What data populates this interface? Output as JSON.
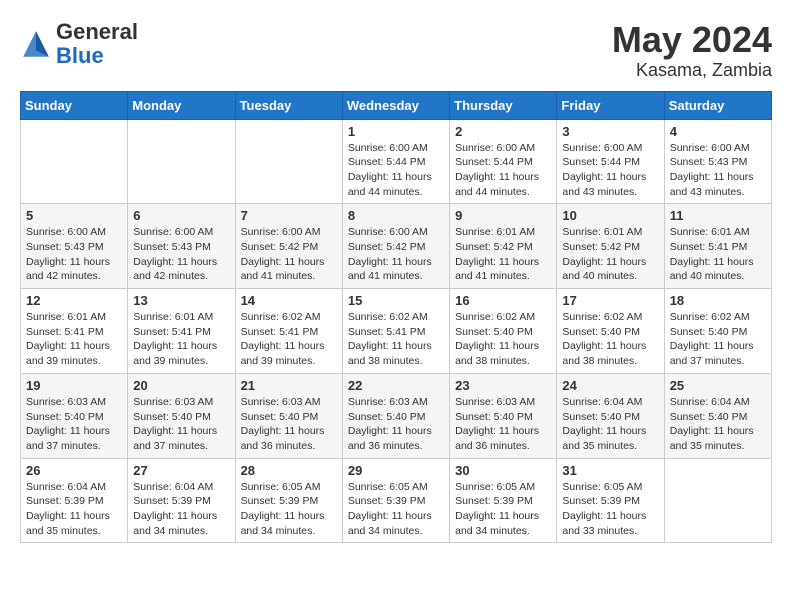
{
  "header": {
    "logo": {
      "general": "General",
      "blue": "Blue"
    },
    "title": "May 2024",
    "location": "Kasama, Zambia"
  },
  "weekdays": [
    "Sunday",
    "Monday",
    "Tuesday",
    "Wednesday",
    "Thursday",
    "Friday",
    "Saturday"
  ],
  "weeks": [
    [
      {
        "day": "",
        "info": ""
      },
      {
        "day": "",
        "info": ""
      },
      {
        "day": "",
        "info": ""
      },
      {
        "day": "1",
        "info": "Sunrise: 6:00 AM\nSunset: 5:44 PM\nDaylight: 11 hours\nand 44 minutes."
      },
      {
        "day": "2",
        "info": "Sunrise: 6:00 AM\nSunset: 5:44 PM\nDaylight: 11 hours\nand 44 minutes."
      },
      {
        "day": "3",
        "info": "Sunrise: 6:00 AM\nSunset: 5:44 PM\nDaylight: 11 hours\nand 43 minutes."
      },
      {
        "day": "4",
        "info": "Sunrise: 6:00 AM\nSunset: 5:43 PM\nDaylight: 11 hours\nand 43 minutes."
      }
    ],
    [
      {
        "day": "5",
        "info": "Sunrise: 6:00 AM\nSunset: 5:43 PM\nDaylight: 11 hours\nand 42 minutes."
      },
      {
        "day": "6",
        "info": "Sunrise: 6:00 AM\nSunset: 5:43 PM\nDaylight: 11 hours\nand 42 minutes."
      },
      {
        "day": "7",
        "info": "Sunrise: 6:00 AM\nSunset: 5:42 PM\nDaylight: 11 hours\nand 41 minutes."
      },
      {
        "day": "8",
        "info": "Sunrise: 6:00 AM\nSunset: 5:42 PM\nDaylight: 11 hours\nand 41 minutes."
      },
      {
        "day": "9",
        "info": "Sunrise: 6:01 AM\nSunset: 5:42 PM\nDaylight: 11 hours\nand 41 minutes."
      },
      {
        "day": "10",
        "info": "Sunrise: 6:01 AM\nSunset: 5:42 PM\nDaylight: 11 hours\nand 40 minutes."
      },
      {
        "day": "11",
        "info": "Sunrise: 6:01 AM\nSunset: 5:41 PM\nDaylight: 11 hours\nand 40 minutes."
      }
    ],
    [
      {
        "day": "12",
        "info": "Sunrise: 6:01 AM\nSunset: 5:41 PM\nDaylight: 11 hours\nand 39 minutes."
      },
      {
        "day": "13",
        "info": "Sunrise: 6:01 AM\nSunset: 5:41 PM\nDaylight: 11 hours\nand 39 minutes."
      },
      {
        "day": "14",
        "info": "Sunrise: 6:02 AM\nSunset: 5:41 PM\nDaylight: 11 hours\nand 39 minutes."
      },
      {
        "day": "15",
        "info": "Sunrise: 6:02 AM\nSunset: 5:41 PM\nDaylight: 11 hours\nand 38 minutes."
      },
      {
        "day": "16",
        "info": "Sunrise: 6:02 AM\nSunset: 5:40 PM\nDaylight: 11 hours\nand 38 minutes."
      },
      {
        "day": "17",
        "info": "Sunrise: 6:02 AM\nSunset: 5:40 PM\nDaylight: 11 hours\nand 38 minutes."
      },
      {
        "day": "18",
        "info": "Sunrise: 6:02 AM\nSunset: 5:40 PM\nDaylight: 11 hours\nand 37 minutes."
      }
    ],
    [
      {
        "day": "19",
        "info": "Sunrise: 6:03 AM\nSunset: 5:40 PM\nDaylight: 11 hours\nand 37 minutes."
      },
      {
        "day": "20",
        "info": "Sunrise: 6:03 AM\nSunset: 5:40 PM\nDaylight: 11 hours\nand 37 minutes."
      },
      {
        "day": "21",
        "info": "Sunrise: 6:03 AM\nSunset: 5:40 PM\nDaylight: 11 hours\nand 36 minutes."
      },
      {
        "day": "22",
        "info": "Sunrise: 6:03 AM\nSunset: 5:40 PM\nDaylight: 11 hours\nand 36 minutes."
      },
      {
        "day": "23",
        "info": "Sunrise: 6:03 AM\nSunset: 5:40 PM\nDaylight: 11 hours\nand 36 minutes."
      },
      {
        "day": "24",
        "info": "Sunrise: 6:04 AM\nSunset: 5:40 PM\nDaylight: 11 hours\nand 35 minutes."
      },
      {
        "day": "25",
        "info": "Sunrise: 6:04 AM\nSunset: 5:40 PM\nDaylight: 11 hours\nand 35 minutes."
      }
    ],
    [
      {
        "day": "26",
        "info": "Sunrise: 6:04 AM\nSunset: 5:39 PM\nDaylight: 11 hours\nand 35 minutes."
      },
      {
        "day": "27",
        "info": "Sunrise: 6:04 AM\nSunset: 5:39 PM\nDaylight: 11 hours\nand 34 minutes."
      },
      {
        "day": "28",
        "info": "Sunrise: 6:05 AM\nSunset: 5:39 PM\nDaylight: 11 hours\nand 34 minutes."
      },
      {
        "day": "29",
        "info": "Sunrise: 6:05 AM\nSunset: 5:39 PM\nDaylight: 11 hours\nand 34 minutes."
      },
      {
        "day": "30",
        "info": "Sunrise: 6:05 AM\nSunset: 5:39 PM\nDaylight: 11 hours\nand 34 minutes."
      },
      {
        "day": "31",
        "info": "Sunrise: 6:05 AM\nSunset: 5:39 PM\nDaylight: 11 hours\nand 33 minutes."
      },
      {
        "day": "",
        "info": ""
      }
    ]
  ]
}
